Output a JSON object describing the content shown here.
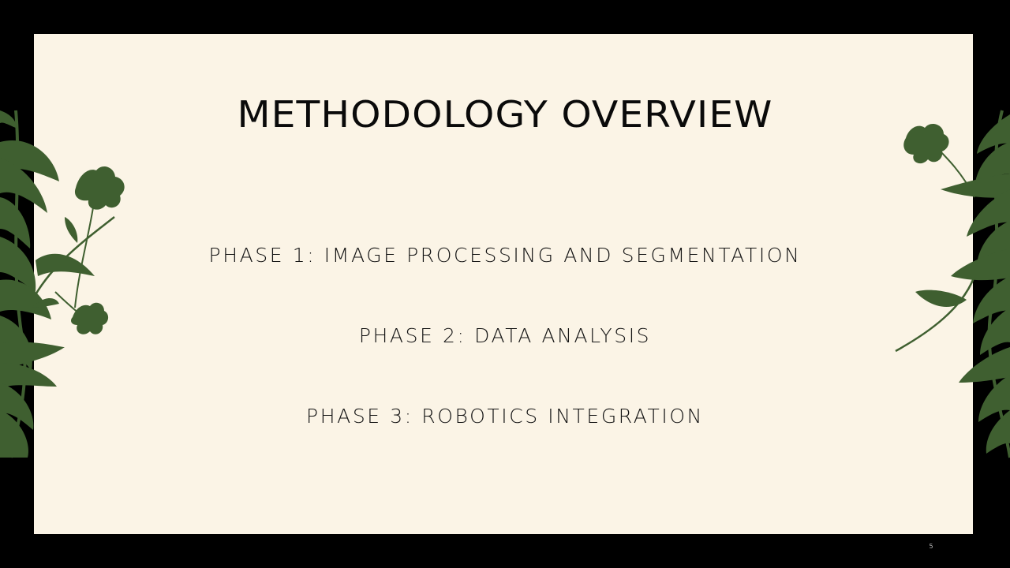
{
  "slide": {
    "title": "METHODOLOGY OVERVIEW",
    "phases": [
      "PHASE 1: IMAGE PROCESSING AND SEGMENTATION",
      "PHASE 2: DATA ANALYSIS",
      "PHASE 3: ROBOTICS INTEGRATION"
    ],
    "page_number": "5"
  },
  "colors": {
    "background": "#000000",
    "slide": "#FBF4E6",
    "text": "#141414",
    "foliage": "#3F5F30"
  },
  "decorations": {
    "left": "leaf-foliage-left-icon",
    "right": "leaf-foliage-right-icon"
  }
}
